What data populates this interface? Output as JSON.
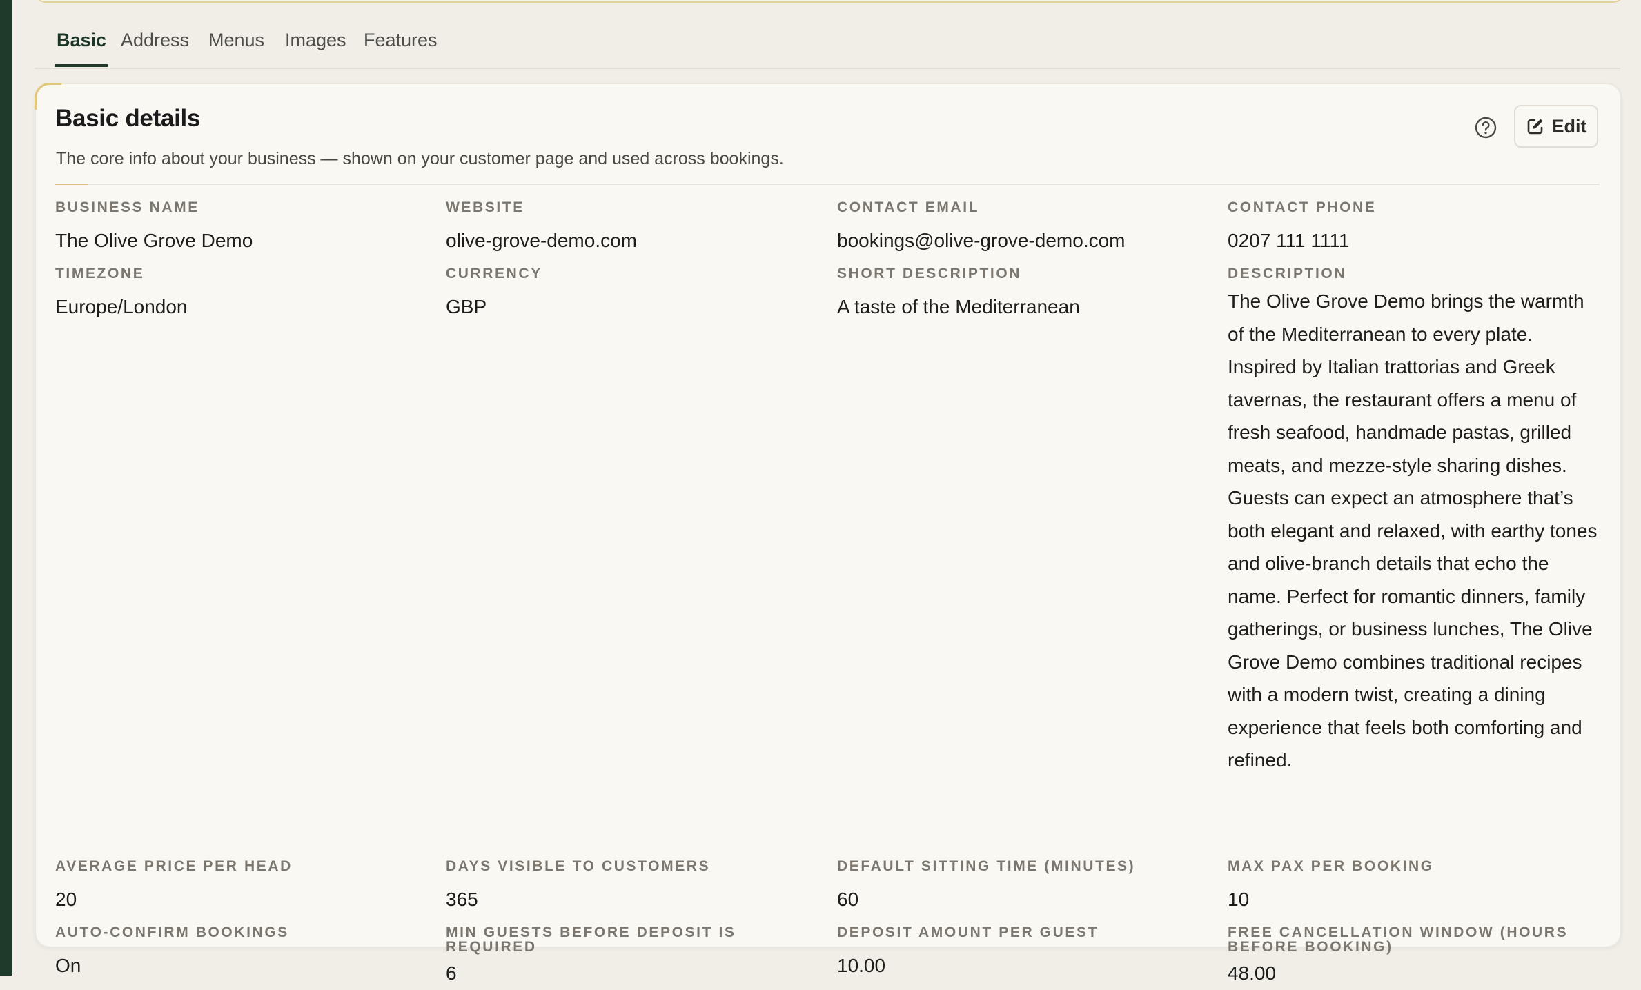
{
  "tabs": [
    {
      "label": "Basic",
      "active": true
    },
    {
      "label": "Address",
      "active": false
    },
    {
      "label": "Menus",
      "active": false
    },
    {
      "label": "Images",
      "active": false
    },
    {
      "label": "Features",
      "active": false
    }
  ],
  "card": {
    "title": "Basic details",
    "subtitle": "The core info about your business — shown on your customer page and used across bookings.",
    "edit_label": "Edit",
    "help_icon": "question-circle-icon",
    "edit_icon": "edit-square-icon"
  },
  "fields": {
    "business_name": {
      "label": "Business name",
      "value": "The Olive Grove Demo"
    },
    "website": {
      "label": "Website",
      "value": "olive-grove-demo.com"
    },
    "contact_email": {
      "label": "Contact email",
      "value": "bookings@olive-grove-demo.com"
    },
    "contact_phone": {
      "label": "Contact phone",
      "value": "0207 111 1111"
    },
    "timezone": {
      "label": "Timezone",
      "value": "Europe/London"
    },
    "currency": {
      "label": "Currency",
      "value": "GBP"
    },
    "short_description": {
      "label": "Short description",
      "value": "A taste of the Mediterranean"
    },
    "description": {
      "label": "Description",
      "value": "The Olive Grove Demo brings the warmth of the Mediterranean to every plate. Inspired by Italian trattorias and Greek tavernas, the restaurant offers a menu of fresh seafood, handmade pastas, grilled meats, and mezze-style sharing dishes. Guests can expect an atmosphere that’s both elegant and relaxed, with earthy tones and olive-branch details that echo the name. Perfect for romantic dinners, family gatherings, or business lunches, The Olive Grove Demo combines traditional recipes with a modern twist, creating a dining experience that feels both comforting and refined."
    },
    "avg_price": {
      "label": "Average price per head",
      "value": "20"
    },
    "days_visible": {
      "label": "Days visible to customers",
      "value": "365"
    },
    "sitting_time": {
      "label": "Default sitting time (minutes)",
      "value": "60"
    },
    "max_pax": {
      "label": "Max pax per booking",
      "value": "10"
    },
    "auto_confirm": {
      "label": "Auto-confirm bookings",
      "value": "On"
    },
    "min_guests_deposit": {
      "label": "Min guests before deposit is required",
      "value": "6"
    },
    "deposit_amount": {
      "label": "Deposit amount per guest",
      "value": "10.00"
    },
    "free_cancellation": {
      "label": "Free cancellation window (hours before booking)",
      "value": "48.00"
    }
  }
}
